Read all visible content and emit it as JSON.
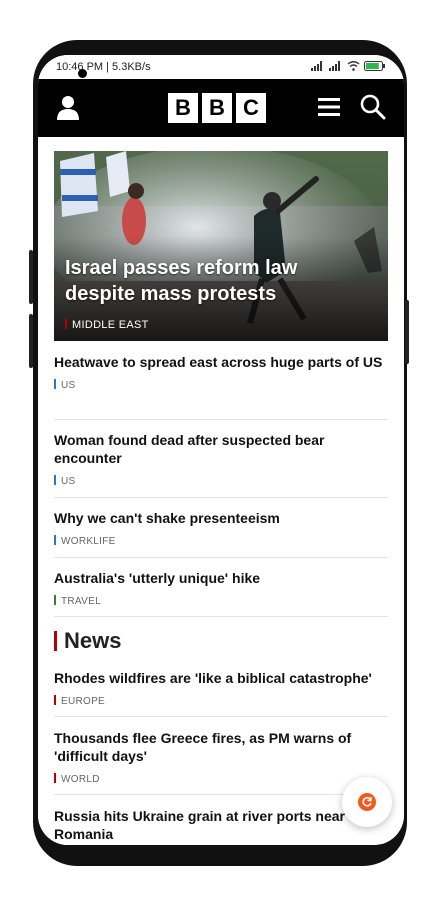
{
  "status_bar": {
    "time": "10:46 PM | 5.3KB/s",
    "battery_level": 0.85
  },
  "header": {
    "logo_letters": [
      "B",
      "B",
      "C"
    ],
    "profile_icon": "person-icon",
    "menu_icon": "hamburger-icon",
    "search_icon": "search-icon",
    "background_color": "#000000"
  },
  "hero": {
    "title": "Israel passes reform law despite mass protests",
    "tag": "MIDDLE EAST",
    "tag_color": "#b80000"
  },
  "stories": [
    {
      "title": "Heatwave to spread east across huge parts of US",
      "tag": "US",
      "tag_color": "#2b7ab8"
    },
    {
      "title": "Woman found dead after suspected bear encounter",
      "tag": "US",
      "tag_color": "#2b7ab8"
    },
    {
      "title": "Why we can't shake presenteeism",
      "tag": "WORKLIFE",
      "tag_color": "#2b7ab8"
    },
    {
      "title": "Australia's 'utterly unique' hike",
      "tag": "TRAVEL",
      "tag_color": "#3a7d3a"
    }
  ],
  "news_section": {
    "heading": "News",
    "accent_color": "#b80000",
    "stories": [
      {
        "title": "Rhodes wildfires are 'like a biblical catastrophe'",
        "tag": "EUROPE",
        "tag_color": "#b80000"
      },
      {
        "title": "Thousands flee Greece fires, as PM warns of 'difficult days'",
        "tag": "WORLD",
        "tag_color": "#b80000"
      },
      {
        "title": "Russia hits Ukraine grain at river ports near Romania",
        "tag": "",
        "tag_color": "#b80000"
      }
    ]
  },
  "fab": {
    "icon": "refresh-icon",
    "color": "#f25a1e"
  }
}
